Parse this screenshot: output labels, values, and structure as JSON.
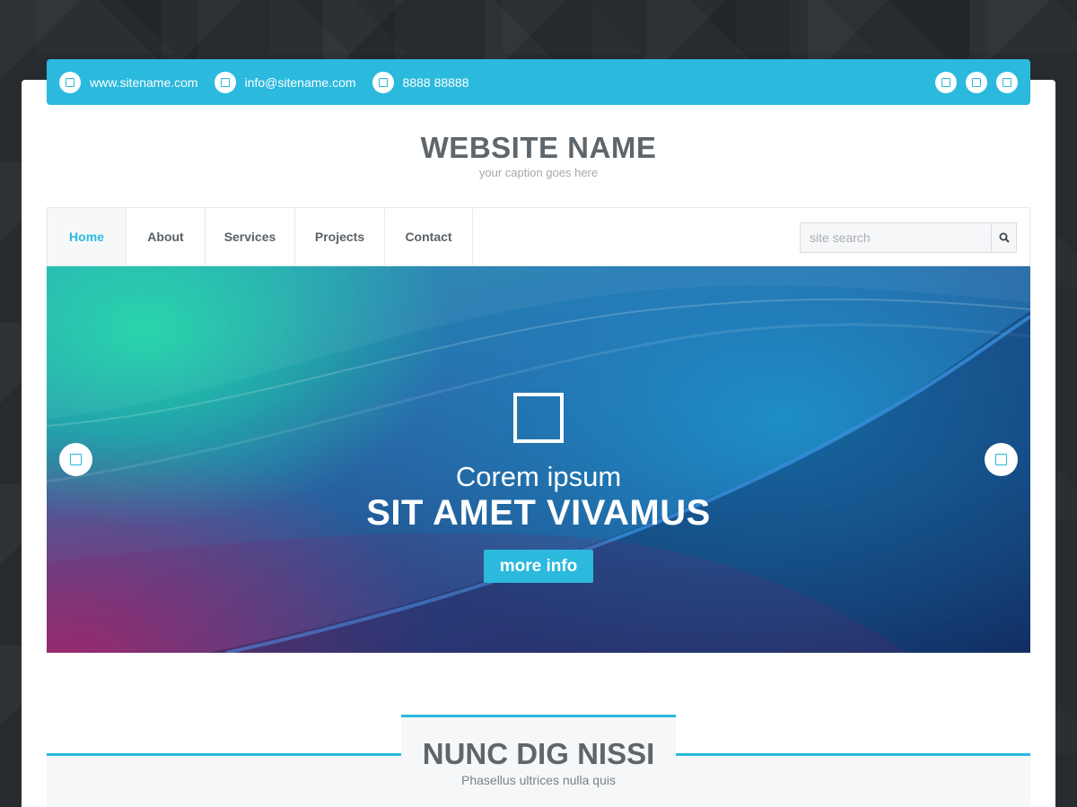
{
  "topbar": {
    "website": "www.sitename.com",
    "email": "info@sitename.com",
    "phone": "8888 88888"
  },
  "header": {
    "title": "WEBSITE NAME",
    "caption": "your caption goes here"
  },
  "nav": {
    "items": [
      {
        "label": "Home",
        "active": true
      },
      {
        "label": "About"
      },
      {
        "label": "Services"
      },
      {
        "label": "Projects"
      },
      {
        "label": "Contact"
      }
    ],
    "search_placeholder": "site search"
  },
  "hero": {
    "subtitle": "Corem ipsum",
    "title": "SIT AMET VIVAMUS",
    "button": "more info"
  },
  "section": {
    "title": "NUNC DIG NISSI",
    "subtitle": "Phasellus ultrices nulla quis"
  },
  "colors": {
    "accent": "#2bb9de",
    "heading": "#5f666b",
    "background": "#272b2f"
  }
}
